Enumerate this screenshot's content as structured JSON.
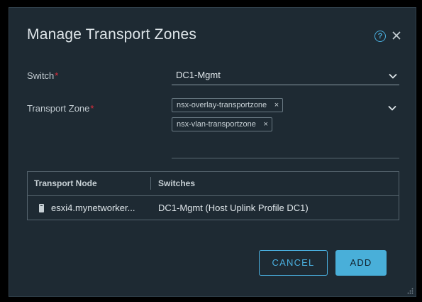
{
  "dialog": {
    "title": "Manage Transport Zones"
  },
  "icons": {
    "help": "help-circle-icon",
    "close": "close-icon",
    "chevron": "chevron-down-icon",
    "host": "host-icon",
    "resize": "resize-grip-icon"
  },
  "form": {
    "switch_label": "Switch",
    "switch_value": "DC1-Mgmt",
    "transport_zone_label": "Transport Zone",
    "required_mark": "*",
    "transport_zones": [
      {
        "label": "nsx-overlay-transportzone",
        "remove": "×"
      },
      {
        "label": "nsx-vlan-transportzone",
        "remove": "×"
      }
    ]
  },
  "table": {
    "columns": [
      "Transport Node",
      "Switches"
    ],
    "rows": [
      {
        "transport_node": "esxi4.mynetworker...",
        "switches": "DC1-Mgmt (Host Uplink Profile DC1)"
      }
    ]
  },
  "buttons": {
    "cancel": "CANCEL",
    "add": "ADD"
  },
  "help_glyph": "?",
  "colors": {
    "background": "#000000",
    "dialog": "#1e2a33",
    "accent": "#49afd9",
    "required": "#e02d3c",
    "text": "#dfe6ea"
  }
}
